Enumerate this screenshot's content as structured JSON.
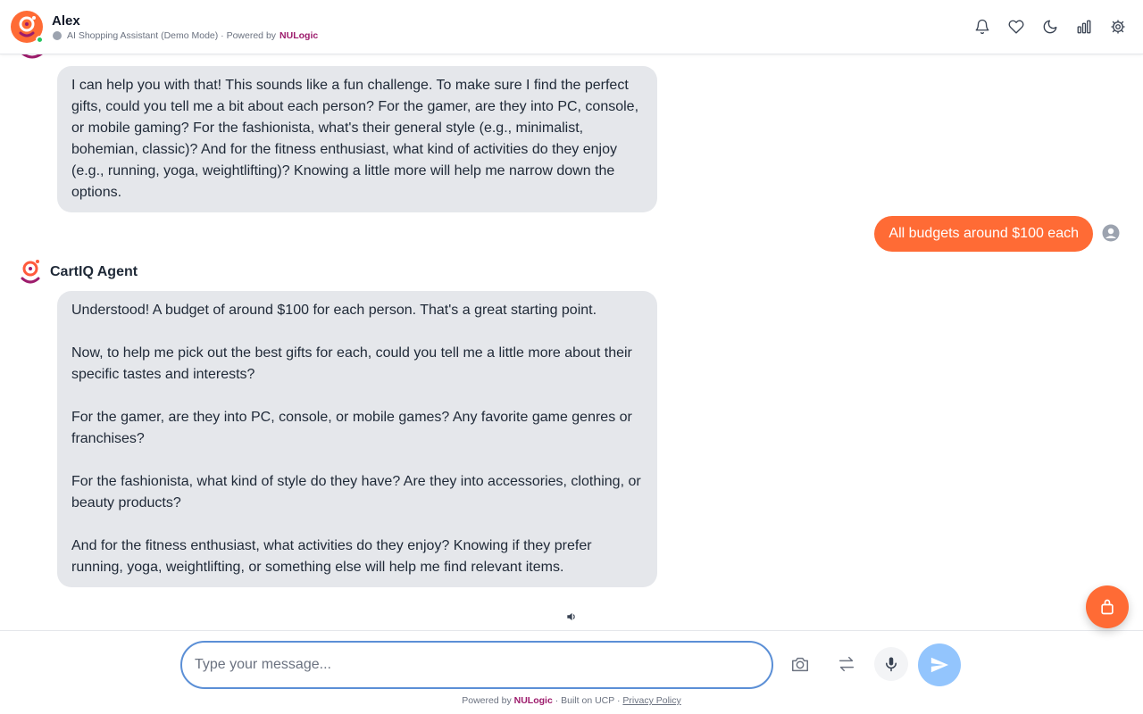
{
  "header": {
    "name": "Alex",
    "subtitle": "AI Shopping Assistant (Demo Mode) · Powered by",
    "brand": "NULogic",
    "icons": [
      "bell-icon",
      "heart-icon",
      "moon-icon",
      "chart-icon",
      "gear-icon"
    ]
  },
  "messages": {
    "agent_1": "I can help you with that! This sounds like a fun challenge. To make sure I find the perfect gifts, could you tell me a bit about each person? For the gamer, are they into PC, console, or mobile gaming? For the fashionista, what's their general style (e.g., minimalist, bohemian, classic)? And for the fitness enthusiast, what kind of activities do they enjoy (e.g., running, yoga, weightlifting)? Knowing a little more will help me narrow down the options.",
    "user_1": "All budgets around $100 each",
    "agent_name": "CartIQ Agent",
    "agent_2": "Understood! A budget of around $100 for each person. That's a great starting point.\n\nNow, to help me pick out the best gifts for each, could you tell me a little more about their specific tastes and interests?\n\nFor the gamer, are they into PC, console, or mobile games? Any favorite game genres or franchises?\n\nFor the fashionista, what kind of style do they have? Are they into accessories, clothing, or beauty products?\n\nAnd for the fitness enthusiast, what activities do they enjoy? Knowing if they prefer running, yoga, weightlifting, or something else will help me find relevant items."
  },
  "composer": {
    "placeholder": "Type your message..."
  },
  "footer": {
    "powered_prefix": "Powered by",
    "brand": "NULogic",
    "built_on": "· Built on UCP ·",
    "privacy": "Privacy Policy"
  },
  "colors": {
    "accent": "#ff6b35",
    "brand": "#9d1c6c",
    "agent_bubble": "#e5e7eb",
    "send_button": "#93c5fd"
  }
}
